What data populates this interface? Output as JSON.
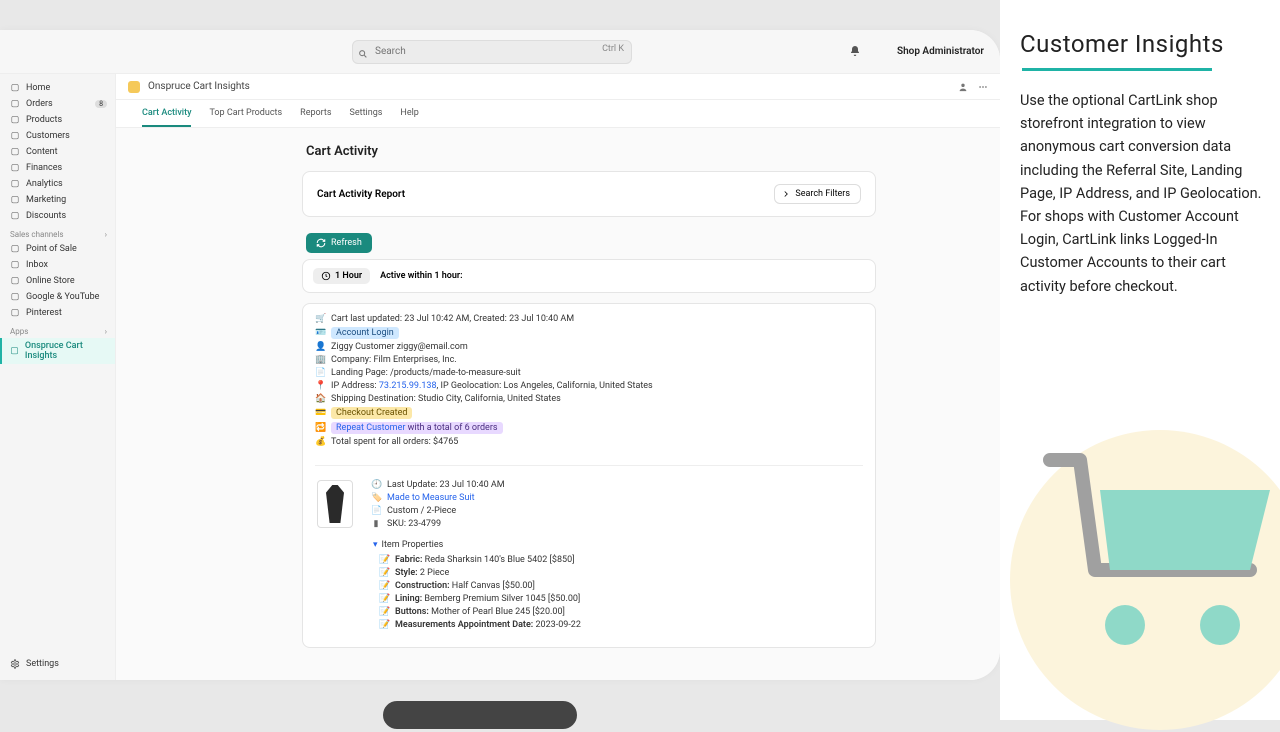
{
  "topbar": {
    "search_placeholder": "Search",
    "kbd_hint": "Ctrl K",
    "admin_label": "Shop Administrator"
  },
  "sidebar": {
    "primary": [
      {
        "label": "Home",
        "icon": "home-icon"
      },
      {
        "label": "Orders",
        "icon": "orders-icon",
        "badge": "8"
      },
      {
        "label": "Products",
        "icon": "products-icon"
      },
      {
        "label": "Customers",
        "icon": "customers-icon"
      },
      {
        "label": "Content",
        "icon": "content-icon"
      },
      {
        "label": "Finances",
        "icon": "finances-icon"
      },
      {
        "label": "Analytics",
        "icon": "analytics-icon"
      },
      {
        "label": "Marketing",
        "icon": "marketing-icon"
      },
      {
        "label": "Discounts",
        "icon": "discounts-icon"
      }
    ],
    "channels_label": "Sales channels",
    "channels": [
      {
        "label": "Point of Sale",
        "icon": "pos-icon"
      },
      {
        "label": "Inbox",
        "icon": "inbox-icon"
      },
      {
        "label": "Online Store",
        "icon": "store-icon"
      },
      {
        "label": "Google & YouTube",
        "icon": "google-icon"
      },
      {
        "label": "Pinterest",
        "icon": "pinterest-icon"
      }
    ],
    "apps_label": "Apps",
    "apps": [
      {
        "label": "Onspruce Cart Insights",
        "icon": "app-icon"
      }
    ],
    "settings_label": "Settings"
  },
  "app_header": {
    "name": "Onspruce Cart Insights"
  },
  "tabs": [
    "Cart Activity",
    "Top Cart Products",
    "Reports",
    "Settings",
    "Help"
  ],
  "page_title": "Cart Activity",
  "report_card_title": "Cart Activity Report",
  "filters_btn": "Search Filters",
  "refresh_btn": "Refresh",
  "hour": {
    "pill": "1 Hour",
    "label": "Active within 1 hour:"
  },
  "cart": {
    "last_updated": "Cart last updated: 23 Jul 10:42 AM, Created: 23 Jul 10:40 AM",
    "account_login": "Account Login",
    "customer": "Ziggy Customer ziggy@email.com",
    "company": "Company: Film Enterprises, Inc.",
    "landing": "Landing Page: /products/made-to-measure-suit",
    "ip_label": "IP Address: ",
    "ip": "73.215.99.138",
    "ip_geo": ", IP Geolocation: Los Angeles, California, United States",
    "shipping": "Shipping Destination: Studio City, California, United States",
    "checkout_created": "Checkout Created",
    "repeat_a": "Repeat Customer",
    "repeat_b": " with a total of 6 orders",
    "total_spent": "Total spent for all orders: $4765"
  },
  "item": {
    "last_update": "Last Update: 23 Jul 10:40 AM",
    "name": "Made to Measure Suit",
    "variant": "Custom / 2-Piece",
    "sku": "SKU: 23-4799",
    "props_header": "Item Properties",
    "props": [
      {
        "k": "Fabric",
        "v": "Reda Sharksin 140's Blue 5402 [$850]"
      },
      {
        "k": "Style",
        "v": "2 Piece"
      },
      {
        "k": "Construction",
        "v": "Half Canvas [$50.00]"
      },
      {
        "k": "Lining",
        "v": "Bemberg Premium Silver 1045 [$50.00]"
      },
      {
        "k": "Buttons",
        "v": "Mother of Pearl Blue 245 [$20.00]"
      },
      {
        "k": "Measurements Appointment Date",
        "v": "2023-09-22"
      }
    ]
  },
  "promo": {
    "title": "Customer Insights",
    "body": "Use the optional CartLink shop storefront integration to view anonymous cart conversion data including the Referral Site, Landing Page, IP Address, and IP Geolocation.  For shops with Customer Account Login, CartLink links Logged-In Customer Accounts to their cart activity before checkout."
  }
}
